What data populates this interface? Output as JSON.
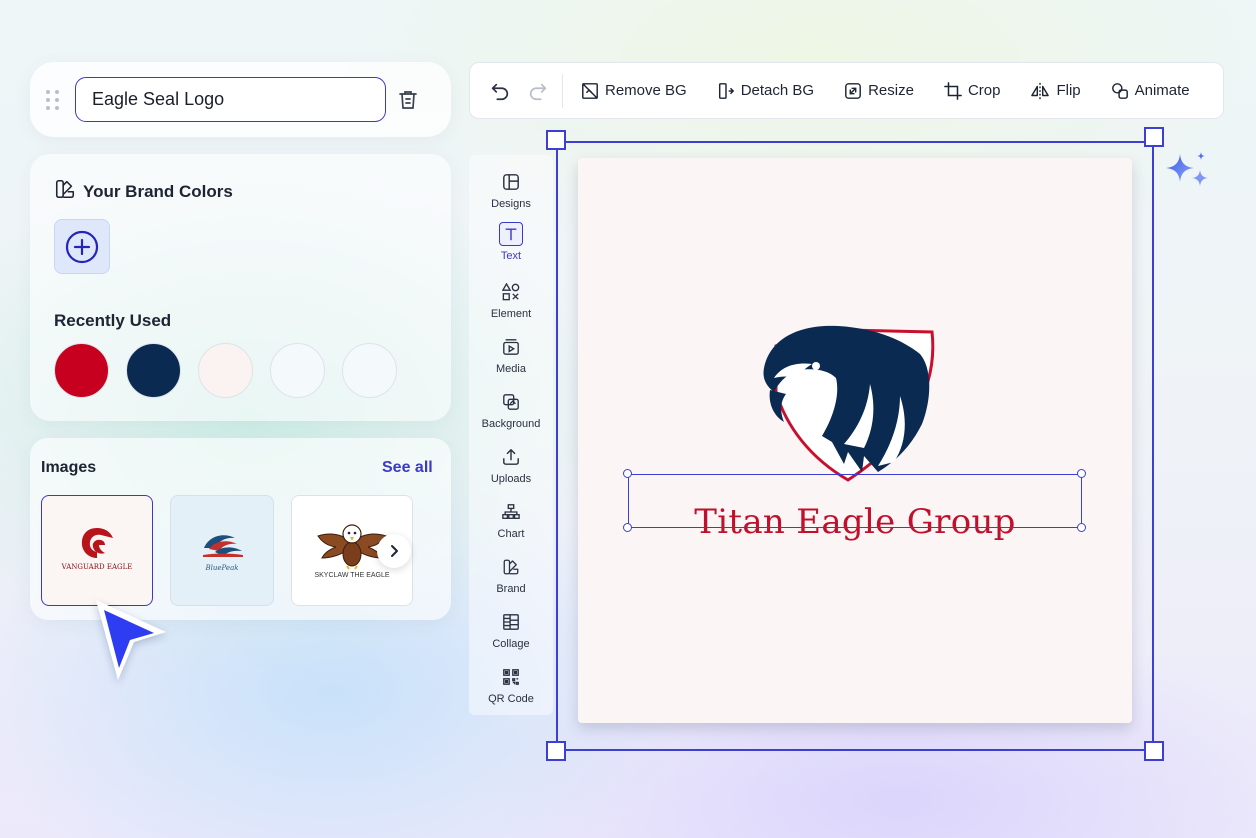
{
  "project": {
    "name": "Eagle Seal Logo"
  },
  "brand_colors": {
    "title": "Your Brand Colors",
    "recently_used_title": "Recently Used",
    "recent_swatches": [
      "#c8001f",
      "#0a2a52",
      "#fbf2f2",
      "#f4f9fb",
      "#f4f9fb"
    ]
  },
  "images": {
    "title": "Images",
    "see_all": "See all",
    "thumbnails": [
      {
        "caption": "VANGUARD EAGLE"
      },
      {
        "caption": "BluePeak"
      },
      {
        "caption": "SKYCLAW THE EAGLE"
      }
    ]
  },
  "toolbar": {
    "remove_bg": "Remove BG",
    "detach_bg": "Detach BG",
    "resize": "Resize",
    "crop": "Crop",
    "flip": "Flip",
    "animate": "Animate"
  },
  "rail": {
    "items": [
      {
        "label": "Designs",
        "icon": "layout-icon"
      },
      {
        "label": "Text",
        "icon": "text-icon"
      },
      {
        "label": "Element",
        "icon": "shapes-icon"
      },
      {
        "label": "Media",
        "icon": "media-icon"
      },
      {
        "label": "Background",
        "icon": "background-icon"
      },
      {
        "label": "Uploads",
        "icon": "upload-icon"
      },
      {
        "label": "Chart",
        "icon": "chart-icon"
      },
      {
        "label": "Brand",
        "icon": "brand-icon"
      },
      {
        "label": "Collage",
        "icon": "collage-icon"
      },
      {
        "label": "QR Code",
        "icon": "qr-code-icon"
      }
    ],
    "active": "Text"
  },
  "canvas": {
    "logo_text": "Titan Eagle Group",
    "logo_text_color": "#c1102b",
    "eagle_color": "#0a2a52",
    "shield_outline_color": "#c8102e"
  },
  "colors": {
    "accent": "#3c3fd0"
  }
}
